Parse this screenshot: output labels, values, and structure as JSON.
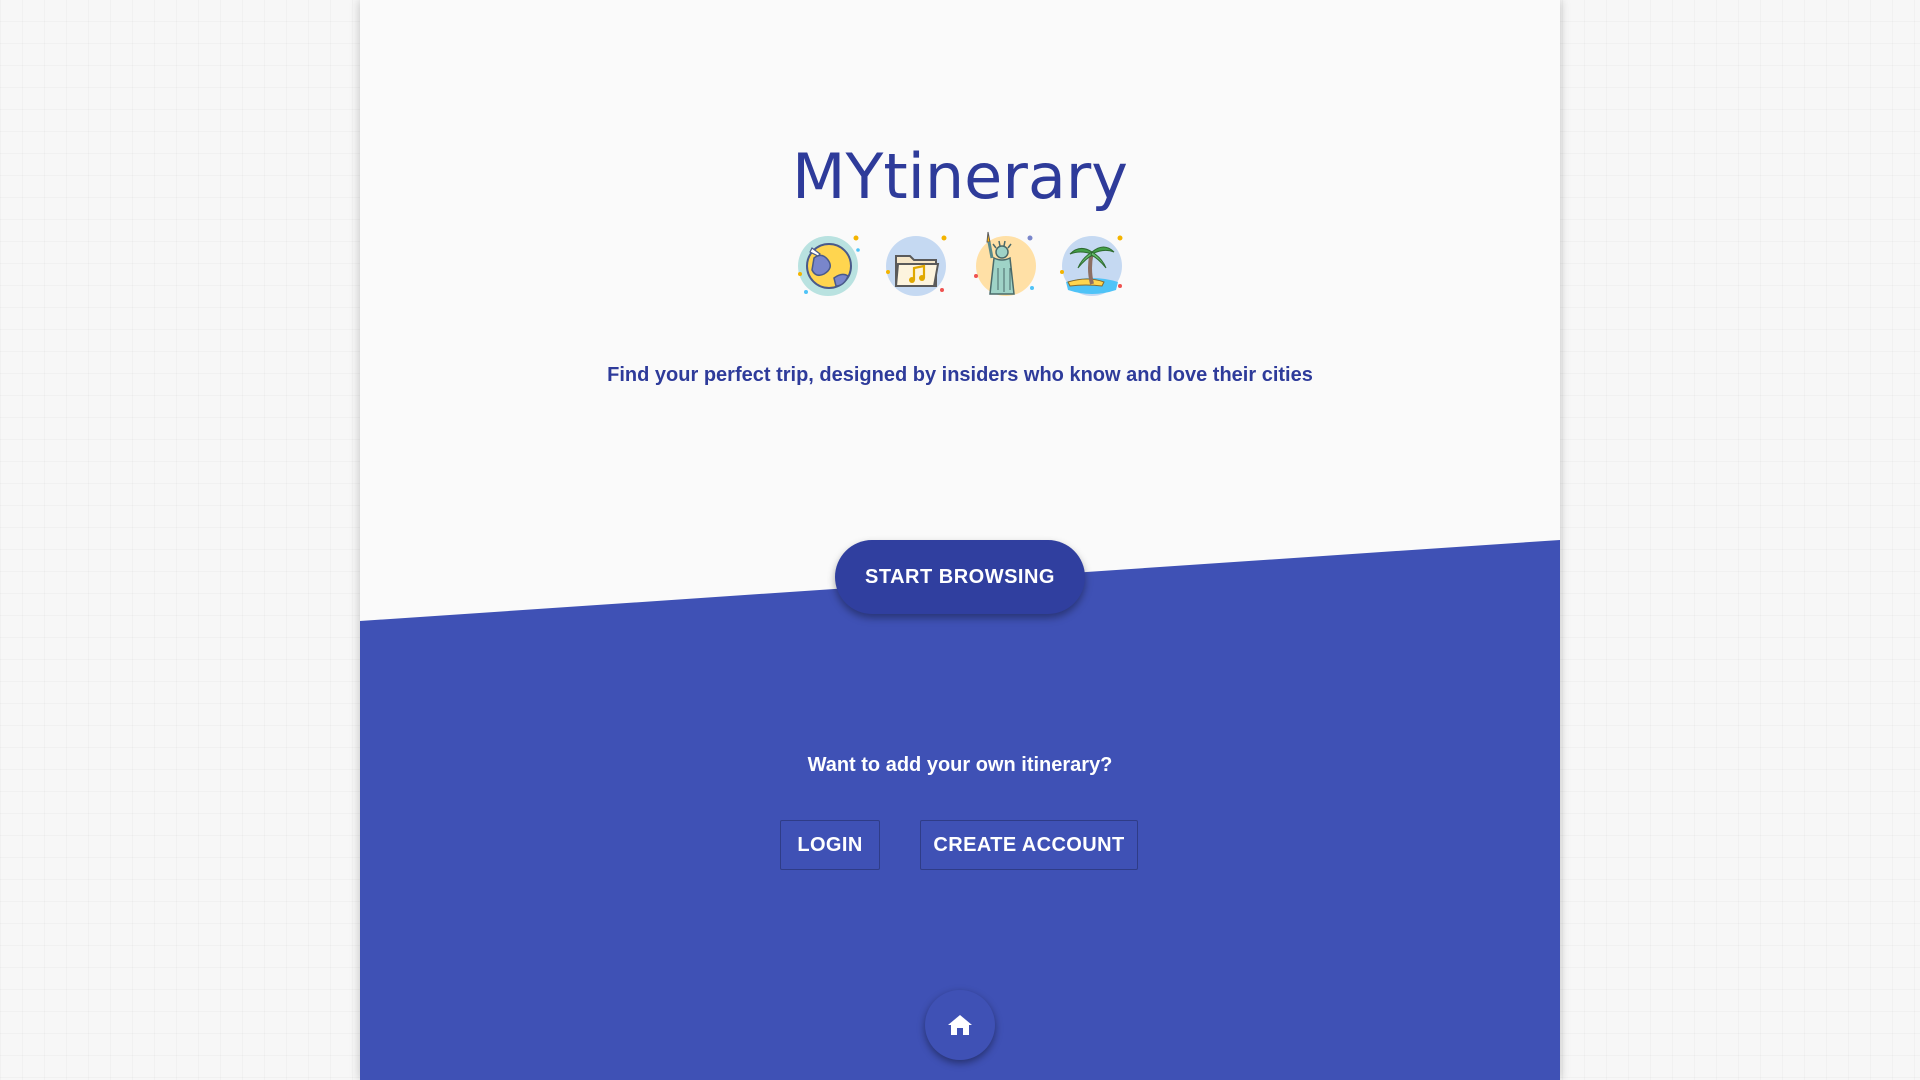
{
  "app": {
    "title": "MYtinerary",
    "tagline": "Find your perfect trip, designed by insiders who know and love their cities"
  },
  "hero": {
    "icons": [
      "globe-plane-icon",
      "music-folder-icon",
      "statue-of-liberty-icon",
      "palm-tree-beach-icon"
    ],
    "start_label": "START BROWSING"
  },
  "account": {
    "prompt": "Want to add your own itinerary?",
    "login_label": "LOGIN",
    "create_label": "CREATE ACCOUNT"
  },
  "footer": {
    "home_icon": "home-icon"
  },
  "colors": {
    "primary": "#3f51b5",
    "primary_dark": "#303f9f",
    "title_text": "#2e3b9a",
    "page_bg": "#fafafa"
  }
}
